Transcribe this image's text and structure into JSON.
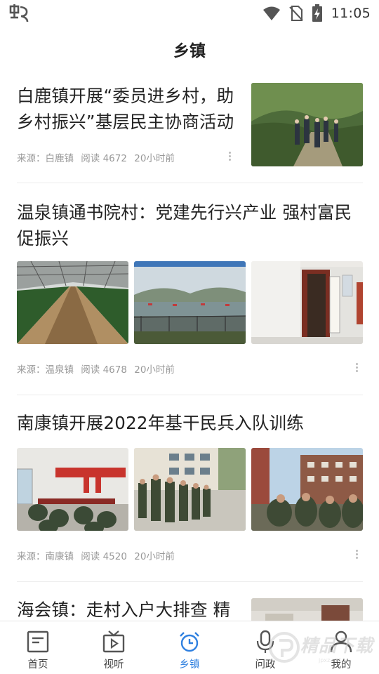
{
  "status_bar": {
    "time": "11:05",
    "icons": [
      "app-logo-icon",
      "wifi-icon",
      "no-sim-icon",
      "battery-charging-icon"
    ]
  },
  "header": {
    "title": "乡镇"
  },
  "articles": [
    {
      "title_line1": "白鹿镇开展“委员进乡村，助",
      "title_line2": "乡村振兴”基层民主协商活动",
      "source": "来源：白鹿镇",
      "reads": "阅读 4672",
      "time": "20小时前"
    },
    {
      "title_line1": "温泉镇通书院村：党建先行兴产业 强村富民",
      "title_line2": "促振兴",
      "source": "来源：温泉镇",
      "reads": "阅读 4678",
      "time": "20小时前"
    },
    {
      "title_line1": "南康镇开展2022年基干民兵入队训练",
      "source": "来源：南康镇",
      "reads": "阅读 4520",
      "time": "20小时前"
    },
    {
      "title_line1": "海会镇：走村入户大排查 精"
    }
  ],
  "bottom_nav": {
    "items": [
      {
        "label": "首页",
        "icon": "news-icon"
      },
      {
        "label": "视听",
        "icon": "video-icon"
      },
      {
        "label": "乡镇",
        "icon": "alarm-clock-icon",
        "active": true
      },
      {
        "label": "问政",
        "icon": "microphone-icon"
      },
      {
        "label": "我的",
        "icon": "user-icon"
      }
    ],
    "active_color": "#2f80e0"
  },
  "watermark": {
    "text": "精品下载",
    "sub": "jpxz.net"
  }
}
